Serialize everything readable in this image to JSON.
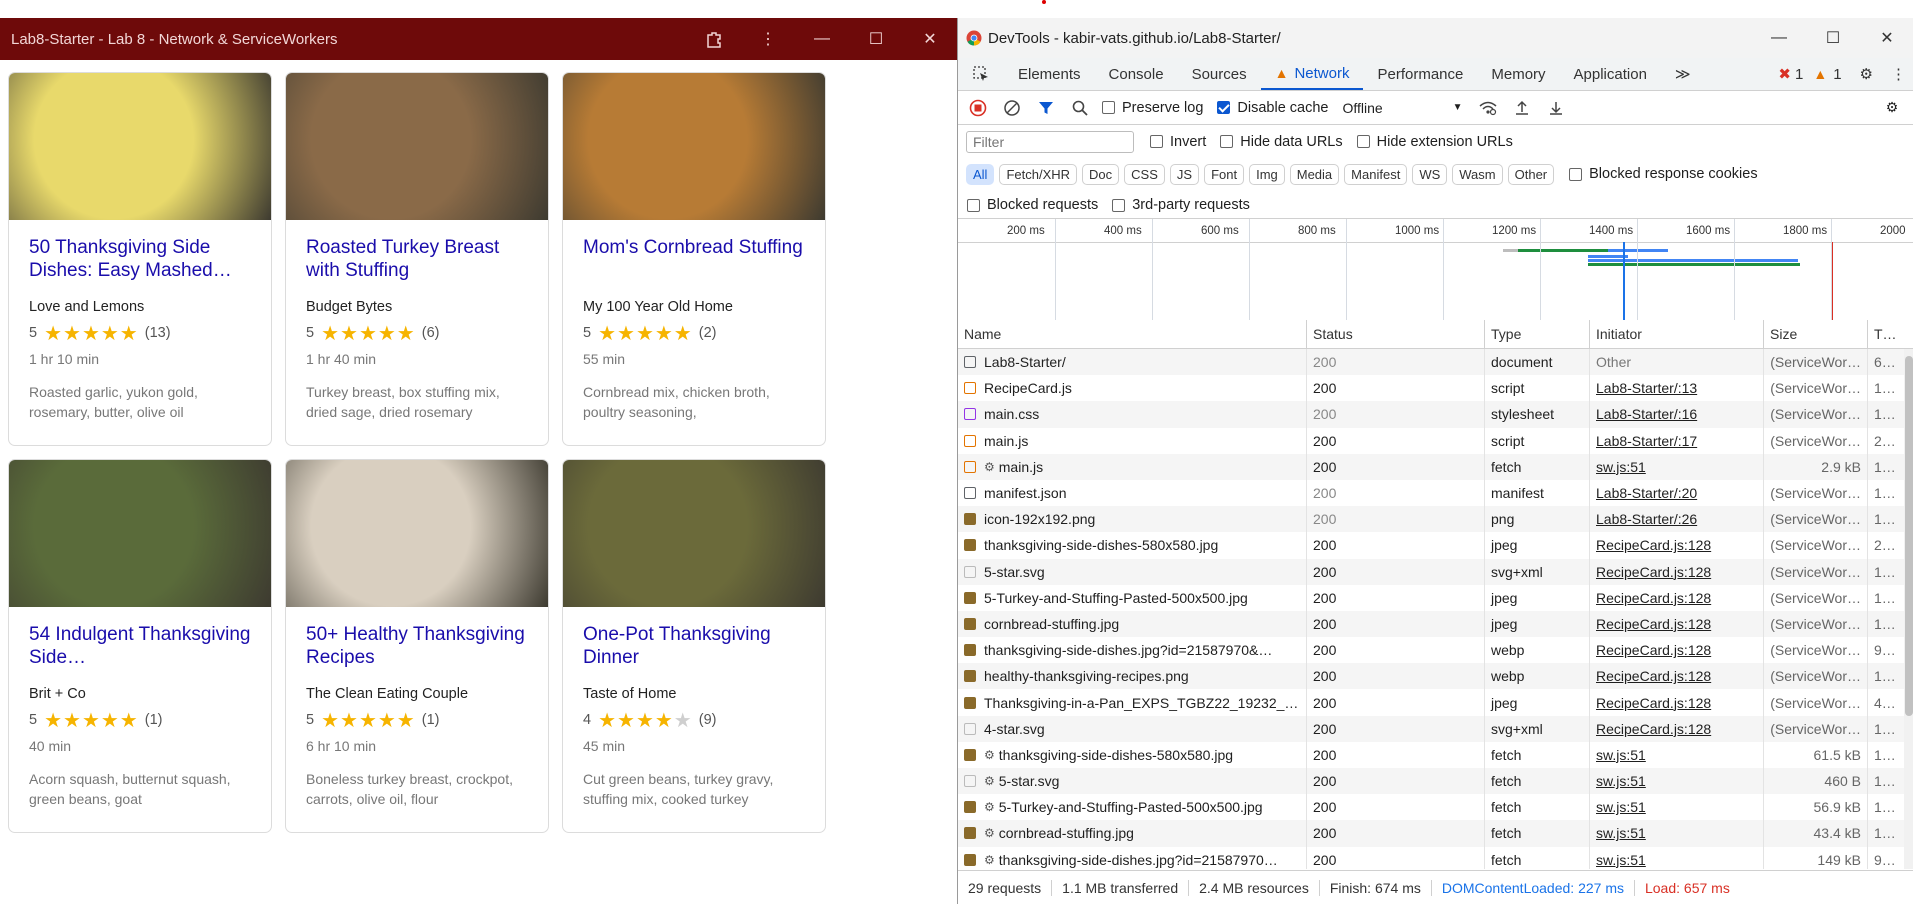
{
  "app": {
    "title": "Lab8-Starter - Lab 8 - Network & ServiceWorkers",
    "cards": [
      {
        "title": "50 Thanksgiving Side Dishes: Easy Mashed…",
        "org": "Love and Lemons",
        "rating": "5",
        "stars": "★★★★★",
        "stars_empty": "",
        "count": "(13)",
        "time": "1 hr 10 min",
        "ingredients": "Roasted garlic, yukon gold, rosemary, butter, olive oil",
        "image": "mashed-potatoes",
        "color": "#e8d96b"
      },
      {
        "title": "Roasted Turkey Breast with Stuffing",
        "org": "Budget Bytes",
        "rating": "5",
        "stars": "★★★★★",
        "stars_empty": "",
        "count": "(6)",
        "time": "1 hr 40 min",
        "ingredients": "Turkey breast, box stuffing mix, dried sage, dried rosemary",
        "image": "turkey-stuffing",
        "color": "#8a6a48"
      },
      {
        "title": "Mom's Cornbread Stuffing",
        "org": "My 100 Year Old Home",
        "rating": "5",
        "stars": "★★★★★",
        "stars_empty": "",
        "count": "(2)",
        "time": "55 min",
        "ingredients": "Cornbread mix, chicken broth, poultry seasoning,",
        "image": "cornbread-stuffing",
        "color": "#b77b35"
      },
      {
        "title": "54 Indulgent Thanksgiving Side…",
        "org": "Brit + Co",
        "rating": "5",
        "stars": "★★★★★",
        "stars_empty": "",
        "count": "(1)",
        "time": "40 min",
        "ingredients": "Acorn squash, butternut squash, green beans, goat",
        "image": "green-beans",
        "color": "#5a6b3a"
      },
      {
        "title": "50+ Healthy Thanksgiving Recipes",
        "org": "The Clean Eating Couple",
        "rating": "5",
        "stars": "★★★★★",
        "stars_empty": "",
        "count": "(1)",
        "time": "6 hr 10 min",
        "ingredients": "Boneless turkey breast, crockpot, carrots, olive oil, flour",
        "image": "turkey-slices",
        "color": "#d9cfc0"
      },
      {
        "title": "One-Pot Thanksgiving Dinner",
        "org": "Taste of Home",
        "rating": "4",
        "stars": "★★★★",
        "stars_empty": "★",
        "count": "(9)",
        "time": "45 min",
        "ingredients": "Cut green beans, turkey gravy, stuffing mix, cooked turkey",
        "image": "one-pot-dinner",
        "color": "#6b6a3a"
      }
    ]
  },
  "devtools": {
    "title": "DevTools - kabir-vats.github.io/Lab8-Starter/",
    "tabs": [
      "Elements",
      "Console",
      "Sources",
      "Network",
      "Performance",
      "Memory",
      "Application"
    ],
    "active_tab": "Network",
    "more_tabs": "≫",
    "error_count": "1",
    "warning_count": "1",
    "toolbar": {
      "preserve_log": "Preserve log",
      "disable_cache": "Disable cache",
      "throttling": "Offline"
    },
    "filter": {
      "placeholder": "Filter",
      "invert": "Invert",
      "hide_data_urls": "Hide data URLs",
      "hide_extension_urls": "Hide extension URLs"
    },
    "type_filters": [
      "All",
      "Fetch/XHR",
      "Doc",
      "CSS",
      "JS",
      "Font",
      "Img",
      "Media",
      "Manifest",
      "WS",
      "Wasm",
      "Other"
    ],
    "blocked_response_cookies": "Blocked response cookies",
    "blocked_requests": "Blocked requests",
    "third_party": "3rd-party requests",
    "timeline_ticks": [
      "200 ms",
      "400 ms",
      "600 ms",
      "800 ms",
      "1000 ms",
      "1200 ms",
      "1400 ms",
      "1600 ms",
      "1800 ms",
      "2000"
    ],
    "columns": [
      "Name",
      "Status",
      "Type",
      "Initiator",
      "Size",
      "T…"
    ],
    "rows": [
      {
        "name": "Lab8-Starter/",
        "status": "200",
        "type": "document",
        "initiator": "Other",
        "size": "(ServiceWor…",
        "time": "6…",
        "sw": false,
        "cached": true,
        "icon": "doc"
      },
      {
        "name": "RecipeCard.js",
        "status": "200",
        "type": "script",
        "initiator": "Lab8-Starter/:13",
        "size": "(ServiceWor…",
        "time": "1…",
        "sw": false,
        "cached": false,
        "icon": "script"
      },
      {
        "name": "main.css",
        "status": "200",
        "type": "stylesheet",
        "initiator": "Lab8-Starter/:16",
        "size": "(ServiceWor…",
        "time": "1…",
        "sw": false,
        "cached": true,
        "icon": "css"
      },
      {
        "name": "main.js",
        "status": "200",
        "type": "script",
        "initiator": "Lab8-Starter/:17",
        "size": "(ServiceWor…",
        "time": "2…",
        "sw": false,
        "cached": false,
        "icon": "script"
      },
      {
        "name": "main.js",
        "status": "200",
        "type": "fetch",
        "initiator": "sw.js:51",
        "size": "2.9 kB",
        "time": "1…",
        "sw": true,
        "cached": false,
        "icon": "script"
      },
      {
        "name": "manifest.json",
        "status": "200",
        "type": "manifest",
        "initiator": "Lab8-Starter/:20",
        "size": "(ServiceWor…",
        "time": "1…",
        "sw": false,
        "cached": true,
        "icon": "doc"
      },
      {
        "name": "icon-192x192.png",
        "status": "200",
        "type": "png",
        "initiator": "Lab8-Starter/:26",
        "size": "(ServiceWor…",
        "time": "1…",
        "sw": false,
        "cached": true,
        "icon": "img"
      },
      {
        "name": "thanksgiving-side-dishes-580x580.jpg",
        "status": "200",
        "type": "jpeg",
        "initiator": "RecipeCard.js:128",
        "size": "(ServiceWor…",
        "time": "2…",
        "sw": false,
        "cached": false,
        "icon": "img"
      },
      {
        "name": "5-star.svg",
        "status": "200",
        "type": "svg+xml",
        "initiator": "RecipeCard.js:128",
        "size": "(ServiceWor…",
        "time": "1…",
        "sw": false,
        "cached": false,
        "icon": "svg"
      },
      {
        "name": "5-Turkey-and-Stuffing-Pasted-500x500.jpg",
        "status": "200",
        "type": "jpeg",
        "initiator": "RecipeCard.js:128",
        "size": "(ServiceWor…",
        "time": "1…",
        "sw": false,
        "cached": false,
        "icon": "img"
      },
      {
        "name": "cornbread-stuffing.jpg",
        "status": "200",
        "type": "jpeg",
        "initiator": "RecipeCard.js:128",
        "size": "(ServiceWor…",
        "time": "1…",
        "sw": false,
        "cached": false,
        "icon": "img"
      },
      {
        "name": "thanksgiving-side-dishes.jpg?id=21587970&…",
        "status": "200",
        "type": "webp",
        "initiator": "RecipeCard.js:128",
        "size": "(ServiceWor…",
        "time": "9…",
        "sw": false,
        "cached": false,
        "icon": "img"
      },
      {
        "name": "healthy-thanksgiving-recipes.png",
        "status": "200",
        "type": "webp",
        "initiator": "RecipeCard.js:128",
        "size": "(ServiceWor…",
        "time": "1…",
        "sw": false,
        "cached": false,
        "icon": "img"
      },
      {
        "name": "Thanksgiving-in-a-Pan_EXPS_TGBZ22_19232_…",
        "status": "200",
        "type": "jpeg",
        "initiator": "RecipeCard.js:128",
        "size": "(ServiceWor…",
        "time": "4…",
        "sw": false,
        "cached": false,
        "icon": "img"
      },
      {
        "name": "4-star.svg",
        "status": "200",
        "type": "svg+xml",
        "initiator": "RecipeCard.js:128",
        "size": "(ServiceWor…",
        "time": "1…",
        "sw": false,
        "cached": false,
        "icon": "svg"
      },
      {
        "name": "thanksgiving-side-dishes-580x580.jpg",
        "status": "200",
        "type": "fetch",
        "initiator": "sw.js:51",
        "size": "61.5 kB",
        "time": "1…",
        "sw": true,
        "cached": false,
        "icon": "img"
      },
      {
        "name": "5-star.svg",
        "status": "200",
        "type": "fetch",
        "initiator": "sw.js:51",
        "size": "460 B",
        "time": "1…",
        "sw": true,
        "cached": false,
        "icon": "svg"
      },
      {
        "name": "5-Turkey-and-Stuffing-Pasted-500x500.jpg",
        "status": "200",
        "type": "fetch",
        "initiator": "sw.js:51",
        "size": "56.9 kB",
        "time": "1…",
        "sw": true,
        "cached": false,
        "icon": "img"
      },
      {
        "name": "cornbread-stuffing.jpg",
        "status": "200",
        "type": "fetch",
        "initiator": "sw.js:51",
        "size": "43.4 kB",
        "time": "1…",
        "sw": true,
        "cached": false,
        "icon": "img"
      },
      {
        "name": "thanksgiving-side-dishes.jpg?id=21587970…",
        "status": "200",
        "type": "fetch",
        "initiator": "sw.js:51",
        "size": "149 kB",
        "time": "9…",
        "sw": true,
        "cached": false,
        "icon": "img"
      }
    ],
    "status_bar": {
      "requests": "29 requests",
      "transferred": "1.1 MB transferred",
      "resources": "2.4 MB resources",
      "finish": "Finish: 674 ms",
      "dom_content_loaded": "DOMContentLoaded: 227 ms",
      "load": "Load: 657 ms"
    },
    "colors": {
      "accent": "#0b57d0",
      "dcl": "#1a73e8",
      "load": "#d93025",
      "error": "#d93025",
      "warning": "#e37400"
    }
  }
}
